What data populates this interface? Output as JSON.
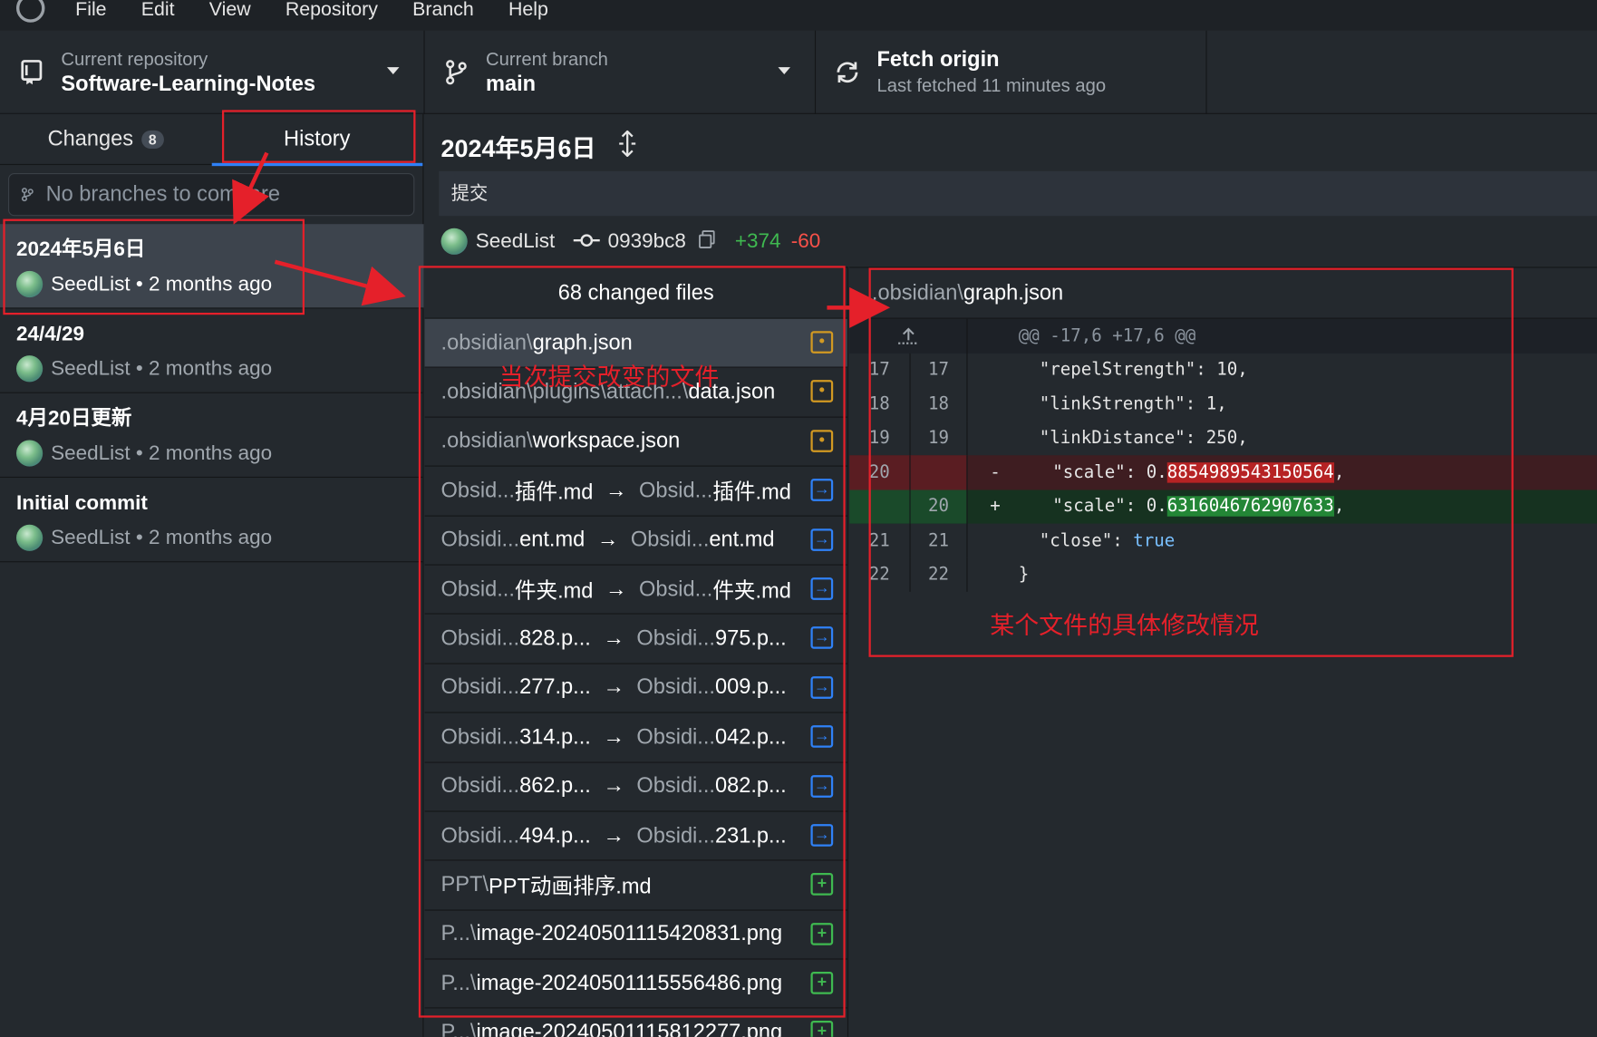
{
  "menu": [
    "File",
    "Edit",
    "View",
    "Repository",
    "Branch",
    "Help"
  ],
  "toolbar": {
    "repo_label": "Current repository",
    "repo_value": "Software-Learning-Notes",
    "branch_label": "Current branch",
    "branch_value": "main",
    "fetch_label": "Fetch origin",
    "fetch_sub": "Last fetched 11 minutes ago"
  },
  "sidebar": {
    "tab_changes": "Changes",
    "tab_changes_count": "8",
    "tab_history": "History",
    "compare_placeholder": "No branches to compare",
    "commits": [
      {
        "title": "2024年5月6日",
        "meta": "SeedList • 2 months ago"
      },
      {
        "title": "24/4/29",
        "meta": "SeedList • 2 months ago"
      },
      {
        "title": "4月20日更新",
        "meta": "SeedList • 2 months ago"
      },
      {
        "title": "Initial commit",
        "meta": "SeedList • 2 months ago"
      }
    ]
  },
  "commit": {
    "title": "2024年5月6日",
    "description": "提交",
    "author": "SeedList",
    "sha": "0939bc8",
    "additions": "+374",
    "deletions": "-60"
  },
  "files": {
    "header": "68 changed files",
    "rows": [
      {
        "dim": ".obsidian\\",
        "name": "graph.json",
        "status": "modified"
      },
      {
        "dim": ".obsidian\\plugins\\attach...\\",
        "name": "data.json",
        "status": "modified"
      },
      {
        "dim": ".obsidian\\",
        "name": "workspace.json",
        "status": "modified"
      },
      {
        "from_dim": "Obsid...",
        "from": "插件.md",
        "to_dim": "Obsid...",
        "to": "插件.md",
        "status": "renamed"
      },
      {
        "from_dim": "Obsidi...",
        "from": "ent.md",
        "to_dim": "Obsidi...",
        "to": "ent.md",
        "status": "renamed"
      },
      {
        "from_dim": "Obsid...",
        "from": "件夹.md",
        "to_dim": "Obsid...",
        "to": "件夹.md",
        "status": "renamed"
      },
      {
        "from_dim": "Obsidi...",
        "from": "828.p...",
        "to_dim": "Obsidi...",
        "to": "975.p...",
        "status": "renamed"
      },
      {
        "from_dim": "Obsidi...",
        "from": "277.p...",
        "to_dim": "Obsidi...",
        "to": "009.p...",
        "status": "renamed"
      },
      {
        "from_dim": "Obsidi...",
        "from": "314.p...",
        "to_dim": "Obsidi...",
        "to": "042.p...",
        "status": "renamed"
      },
      {
        "from_dim": "Obsidi...",
        "from": "862.p...",
        "to_dim": "Obsidi...",
        "to": "082.p...",
        "status": "renamed"
      },
      {
        "from_dim": "Obsidi...",
        "from": "494.p...",
        "to_dim": "Obsidi...",
        "to": "231.p...",
        "status": "renamed"
      },
      {
        "dim": "PPT\\",
        "name": "PPT动画排序.md",
        "status": "added"
      },
      {
        "dim": "P...\\",
        "name": "image-20240501115420831.png",
        "status": "added"
      },
      {
        "dim": "P...\\",
        "name": "image-20240501115556486.png",
        "status": "added"
      },
      {
        "dim": "P...\\",
        "name": "image-20240501115812277.png",
        "status": "added"
      }
    ]
  },
  "diff": {
    "file_dim": ".obsidian\\",
    "file_name": "graph.json",
    "hunk": "@@ -17,6 +17,6 @@",
    "lines": [
      {
        "old": "17",
        "new": "17",
        "sign": "",
        "code": "  \"repelStrength\": 10,",
        "type": "ctx"
      },
      {
        "old": "18",
        "new": "18",
        "sign": "",
        "code": "  \"linkStrength\": 1,",
        "type": "ctx"
      },
      {
        "old": "19",
        "new": "19",
        "sign": "",
        "code": "  \"linkDistance\": 250,",
        "type": "ctx"
      },
      {
        "old": "20",
        "new": "",
        "sign": "-",
        "code_pre": "  \"scale\": 0.",
        "code_hl": "8854989543150564",
        "code_post": ",",
        "type": "del"
      },
      {
        "old": "",
        "new": "20",
        "sign": "+",
        "code_pre": "  \"scale\": 0.",
        "code_hl": "6316046762907633",
        "code_post": ",",
        "type": "add"
      },
      {
        "old": "21",
        "new": "21",
        "sign": "",
        "code_pre": "  \"close\": ",
        "code_kw": "true",
        "type": "ctxkw"
      },
      {
        "old": "22",
        "new": "22",
        "sign": "",
        "code": "}",
        "type": "ctx"
      }
    ]
  },
  "annotations": {
    "files_note": "当次提交改变的文件",
    "diff_note": "某个文件的具体修改情况"
  },
  "colors": {
    "accent": "#2f81f7",
    "annotation_red": "#e5202a",
    "added_green": "#3fb950",
    "removed_red": "#f85149",
    "modified_yellow": "#d29922"
  }
}
